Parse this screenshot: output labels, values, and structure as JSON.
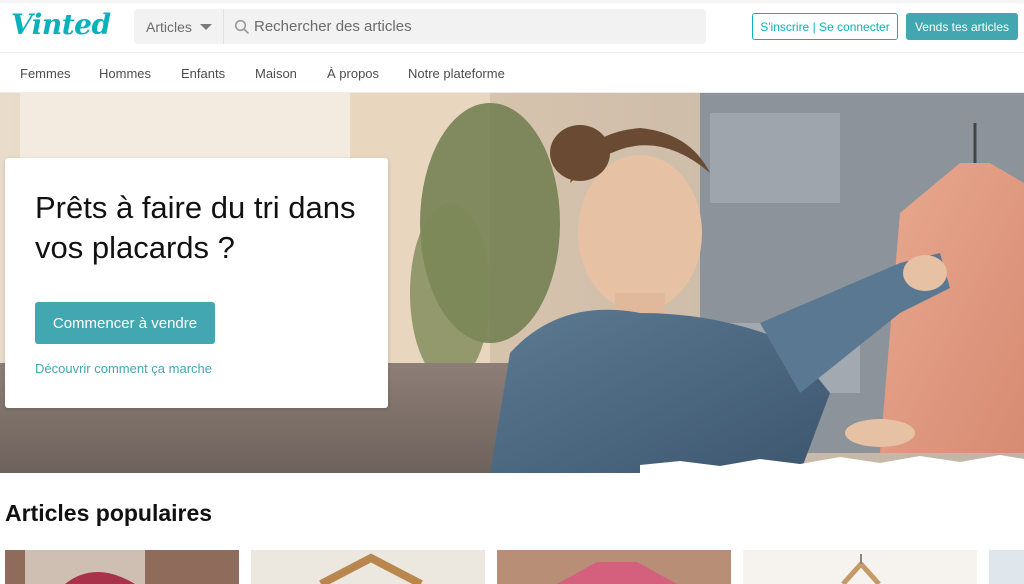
{
  "brand": {
    "logo_text": "Vinted",
    "accent": "#09b1ba",
    "button_color": "#42a7b1"
  },
  "search": {
    "category": "Articles",
    "placeholder": "Rechercher des articles",
    "icon": "search-icon"
  },
  "header": {
    "signup_label": "S'inscrire | Se connecter",
    "sell_label": "Vends tes articles"
  },
  "nav": {
    "items": [
      "Femmes",
      "Hommes",
      "Enfants",
      "Maison",
      "À propos",
      "Notre plateforme"
    ]
  },
  "hero": {
    "title": "Prêts à faire du tri dans vos placards ?",
    "cta_label": "Commencer à vendre",
    "link_label": "Découvrir comment ça marche"
  },
  "popular": {
    "title": "Articles populaires"
  }
}
